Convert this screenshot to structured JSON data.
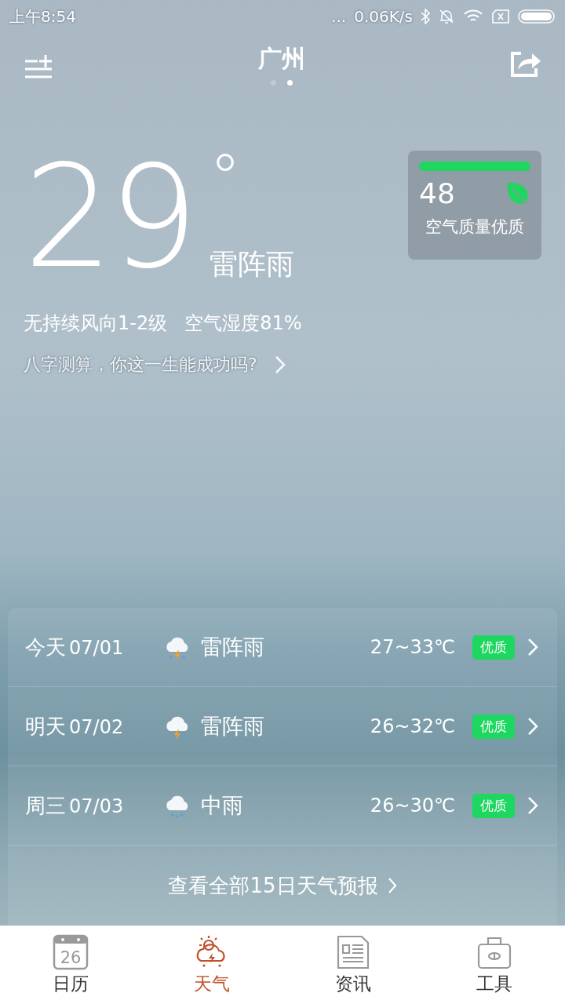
{
  "status_bar": {
    "time": "上午8:54",
    "more": "...",
    "speed": "0.06K/s"
  },
  "header": {
    "city": "广州",
    "pages": [
      {
        "selected": false
      },
      {
        "selected": true
      }
    ]
  },
  "current": {
    "temperature": "29",
    "degree": "°",
    "condition": "雷阵雨",
    "wind": "无持续风向1-2级",
    "humidity": "空气湿度81%",
    "promo_link": "八字测算，你这一生能成功吗?"
  },
  "air_quality": {
    "value": "48",
    "label": "空气质量优质",
    "color": "#1ed760"
  },
  "forecast": [
    {
      "day": "今天",
      "date": "07/01",
      "kind": "thunderstorm",
      "condition": "雷阵雨",
      "temp": "27~33℃",
      "quality": "优质",
      "color": "#1ed760"
    },
    {
      "day": "明天",
      "date": "07/02",
      "kind": "thunderstorm",
      "condition": "雷阵雨",
      "temp": "26~32℃",
      "quality": "优质",
      "color": "#1ed760"
    },
    {
      "day": "周三",
      "date": "07/03",
      "kind": "rain",
      "condition": "中雨",
      "temp": "26~30℃",
      "quality": "优质",
      "color": "#1ed760"
    }
  ],
  "forecast_link": "查看全部15日天气预报",
  "tabs": [
    {
      "kind": "calendar",
      "label": "日历",
      "date": "26",
      "selected": false
    },
    {
      "kind": "weather",
      "label": "天气",
      "selected": true
    },
    {
      "kind": "news",
      "label": "资讯",
      "selected": false
    },
    {
      "kind": "tools",
      "label": "工具",
      "selected": false
    }
  ]
}
